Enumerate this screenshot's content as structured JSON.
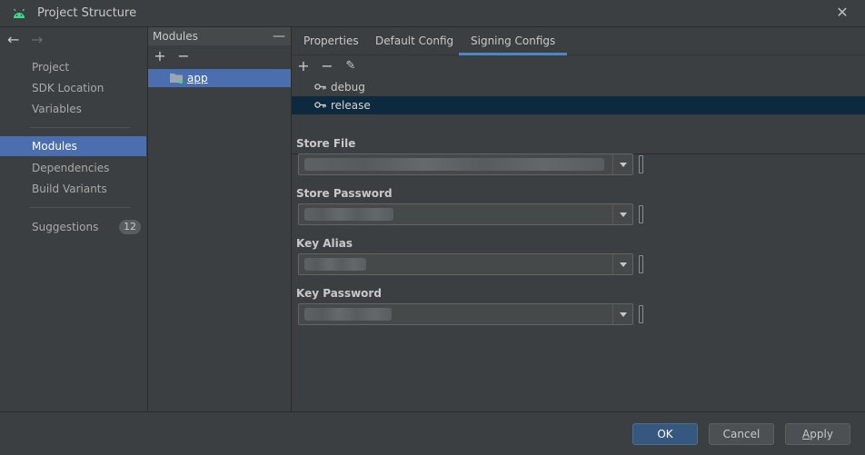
{
  "window": {
    "title": "Project Structure",
    "close_glyph": "✕",
    "icon": "android-icon"
  },
  "nav": {
    "back_glyph": "←",
    "forward_glyph": "→",
    "items": [
      {
        "label": "Project"
      },
      {
        "label": "SDK Location"
      },
      {
        "label": "Variables"
      },
      {
        "label": "Modules"
      },
      {
        "label": "Dependencies"
      },
      {
        "label": "Build Variants"
      },
      {
        "label": "Suggestions",
        "count": "12"
      }
    ],
    "selected": "Modules"
  },
  "modules_panel": {
    "header": "Modules",
    "collapse_glyph": "—",
    "add_glyph": "+",
    "remove_glyph": "−",
    "items": [
      {
        "label": "app"
      }
    ]
  },
  "tabs": [
    {
      "label": "Properties"
    },
    {
      "label": "Default Config"
    },
    {
      "label": "Signing Configs"
    }
  ],
  "active_tab": "Signing Configs",
  "signing": {
    "add_glyph": "+",
    "remove_glyph": "−",
    "edit_glyph": "✎",
    "configs": [
      {
        "label": "debug"
      },
      {
        "label": "release"
      }
    ],
    "selected": "release",
    "fields": {
      "store_file": {
        "label": "Store File"
      },
      "store_password": {
        "label": "Store Password"
      },
      "key_alias": {
        "label": "Key Alias"
      },
      "key_password": {
        "label": "Key Password"
      }
    }
  },
  "buttons": {
    "ok": "OK",
    "cancel": "Cancel",
    "apply_mnemonic": "A",
    "apply_rest": "pply"
  },
  "colors": {
    "background": "#3c3f41",
    "selection": "#4b6eaf",
    "list_selection": "#0d293e",
    "tab_underline": "#4a88c7",
    "primary_button": "#365880",
    "android_green": "#3ddc84"
  }
}
